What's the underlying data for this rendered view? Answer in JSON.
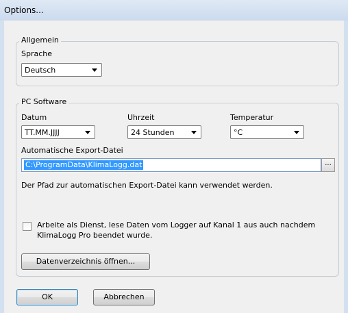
{
  "window": {
    "title": "Options..."
  },
  "general": {
    "legend": "Allgemein",
    "language_label": "Sprache",
    "language_value": "Deutsch"
  },
  "pc_software": {
    "legend": "PC Software",
    "date_label": "Datum",
    "date_value": "TT.MM.JJJJ",
    "time_label": "Uhrzeit",
    "time_value": "24 Stunden",
    "temp_label": "Temperatur",
    "temp_value": "°C",
    "export_label": "Automatische Export-Datei",
    "export_value": "C:\\ProgramData\\KlimaLogg.dat",
    "browse_label": "...",
    "hint": "Der Pfad zur automatischen Export-Datei kann verwendet werden.",
    "service_checkbox_line1": "Arbeite als Dienst, lese Daten vom Logger auf Kanal 1 aus auch nachdem",
    "service_checkbox_line2": "KlimaLogg Pro beendet wurde.",
    "service_checked": false,
    "open_dir_button": "Datenverzeichnis öffnen..."
  },
  "footer": {
    "ok": "OK",
    "cancel": "Abbrechen"
  }
}
